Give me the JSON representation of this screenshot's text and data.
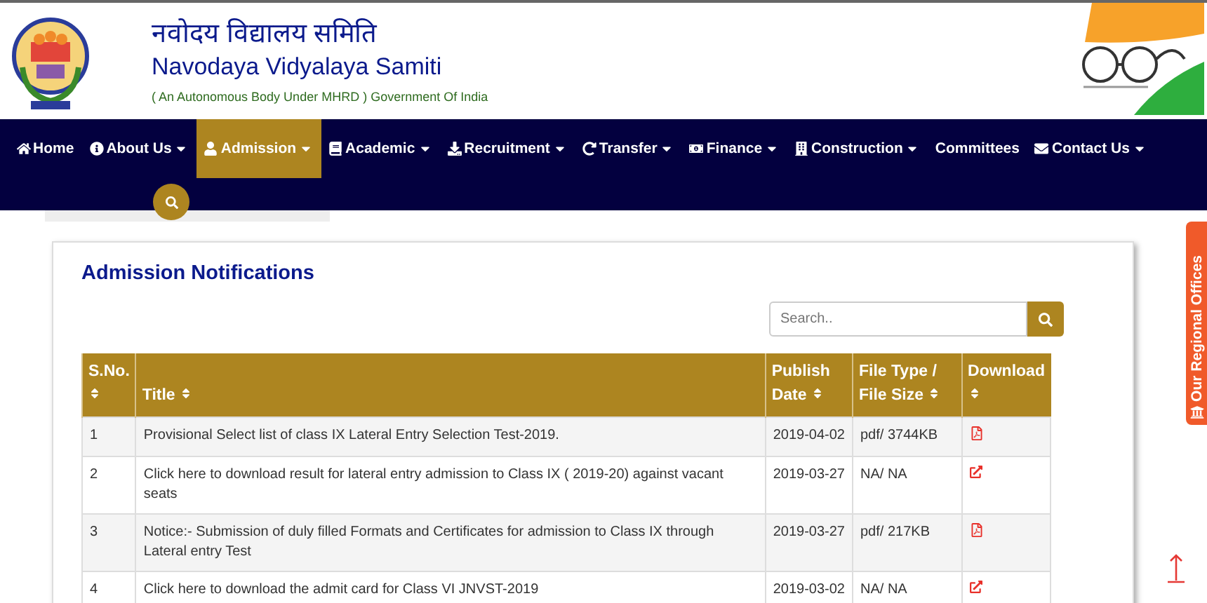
{
  "header": {
    "title_hindi": "नवोदय विद्यालय समिति",
    "title": "Navodaya Vidyalaya Samiti",
    "subtitle": "( An Autonomous Body Under MHRD ) Government Of India"
  },
  "nav": [
    {
      "label": "Home",
      "caret": false,
      "selected": false
    },
    {
      "label": "About Us",
      "caret": true,
      "selected": false
    },
    {
      "label": "Admission",
      "caret": true,
      "selected": true
    },
    {
      "label": "Academic",
      "caret": true,
      "selected": false
    },
    {
      "label": "Recruitment",
      "caret": true,
      "selected": false
    },
    {
      "label": "Transfer",
      "caret": true,
      "selected": false
    },
    {
      "label": "Finance",
      "caret": true,
      "selected": false
    },
    {
      "label": "Construction",
      "caret": true,
      "selected": false
    },
    {
      "label": "Committees",
      "caret": false,
      "selected": false
    },
    {
      "label": "Contact Us",
      "caret": true,
      "selected": false
    }
  ],
  "panel": {
    "title": "Admission Notifications",
    "search": {
      "placeholder": "Search.."
    },
    "table": {
      "columns": [
        {
          "label": "S.No.",
          "sortable": true
        },
        {
          "label": "Title",
          "sortable": true
        },
        {
          "label": "Publish Date",
          "sortable": true
        },
        {
          "label": "File Type / File Size",
          "sortable": true
        },
        {
          "label": "Download",
          "sortable": true
        }
      ],
      "rows": [
        {
          "sno": "1",
          "title": "Provisional Select list of class IX Lateral Entry Selection Test-2019.",
          "date": "2019-04-02",
          "file": "pdf/ 3744KB",
          "kind": "pdf"
        },
        {
          "sno": "2",
          "title": "Click here to download result for lateral entry admission to Class IX ( 2019-20) against vacant seats",
          "date": "2019-03-27",
          "file": "NA/ NA",
          "kind": "link"
        },
        {
          "sno": "3",
          "title": "Notice:- Submission of duly filled Formats and Certificates for admission to Class IX through Lateral entry Test",
          "date": "2019-03-27",
          "file": "pdf/ 217KB",
          "kind": "pdf"
        },
        {
          "sno": "4",
          "title": "Click here to download the admit card for Class VI JNVST-2019",
          "date": "2019-03-02",
          "file": "NA/ NA",
          "kind": "link"
        }
      ]
    }
  },
  "side_tab": {
    "label": "Our Regional Offices"
  }
}
